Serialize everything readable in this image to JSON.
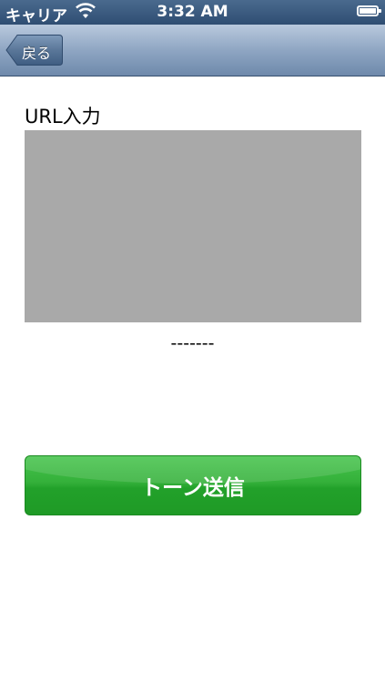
{
  "status_bar": {
    "carrier": "キャリア",
    "time": "3:32 AM",
    "wifi_icon": "wifi-icon",
    "battery_icon": "battery-icon"
  },
  "nav": {
    "back_label": "戻る"
  },
  "main": {
    "url_label": "URL入力",
    "placeholder_text": "-------",
    "send_button_label": "トーン送信"
  },
  "colors": {
    "nav_bar": "#8fa6c3",
    "content_box": "#a9a9a9",
    "send_button": "#2aa832"
  }
}
